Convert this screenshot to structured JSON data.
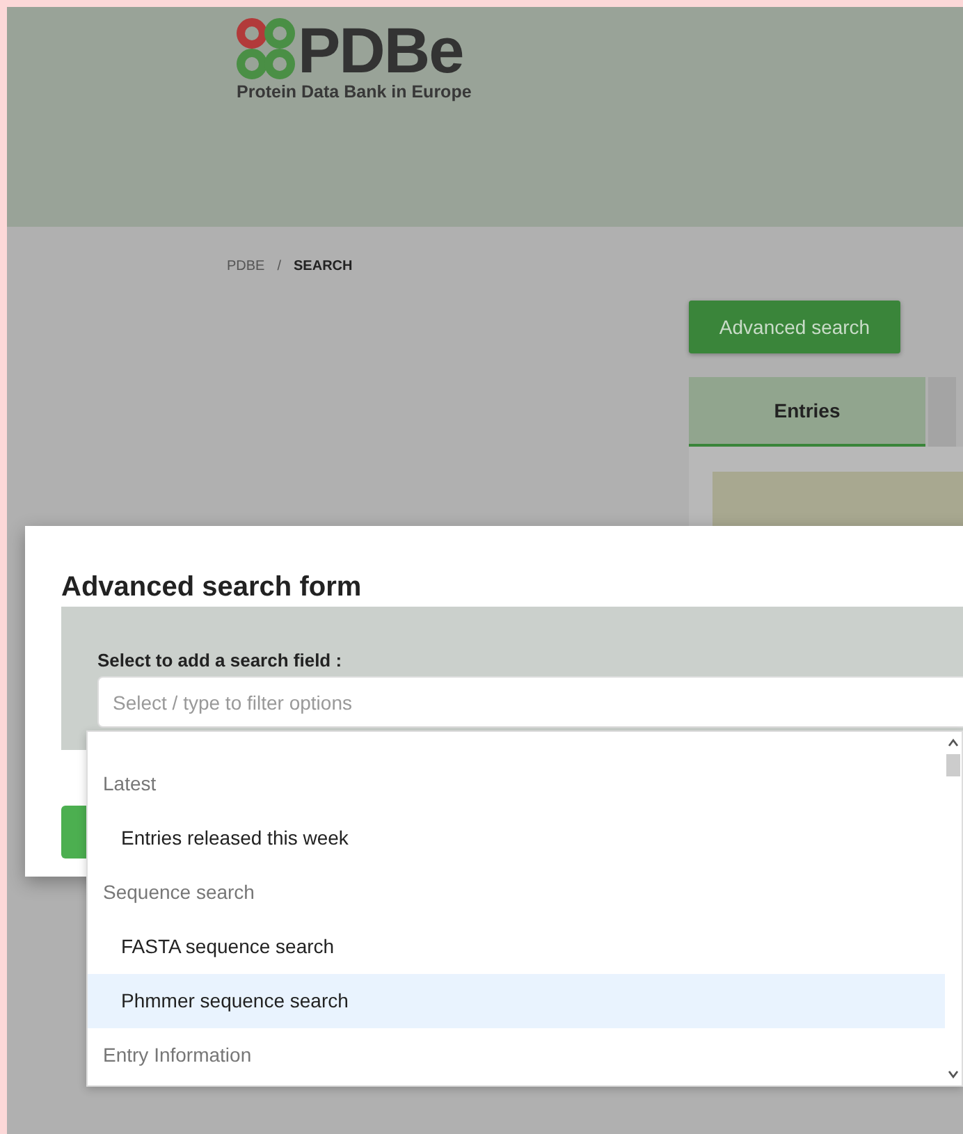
{
  "header": {
    "logo_mark": "PDBe",
    "logo_subtitle": "Protein Data Bank in Europe"
  },
  "breadcrumb": [
    {
      "label": "PDBE",
      "current": false
    },
    {
      "label": "SEARCH",
      "current": true
    }
  ],
  "breadcrumb_separator": "/",
  "advanced_search_button": "Advanced search",
  "tabs": [
    {
      "label": "Entries",
      "selected": true
    }
  ],
  "modal": {
    "title": "Advanced search form",
    "field_label": "Select to add a search field :",
    "select": {
      "placeholder": "Select / type to filter options"
    },
    "options": [
      {
        "kind": "group",
        "label": "Latest",
        "selected": false
      },
      {
        "kind": "option",
        "label": "Entries released this week",
        "selected": false
      },
      {
        "kind": "group",
        "label": "Sequence search",
        "selected": false
      },
      {
        "kind": "option",
        "label": "FASTA sequence search",
        "selected": false
      },
      {
        "kind": "option",
        "label": "Phmmer sequence search",
        "selected": true
      },
      {
        "kind": "group",
        "label": "Entry Information",
        "selected": false
      }
    ]
  }
}
